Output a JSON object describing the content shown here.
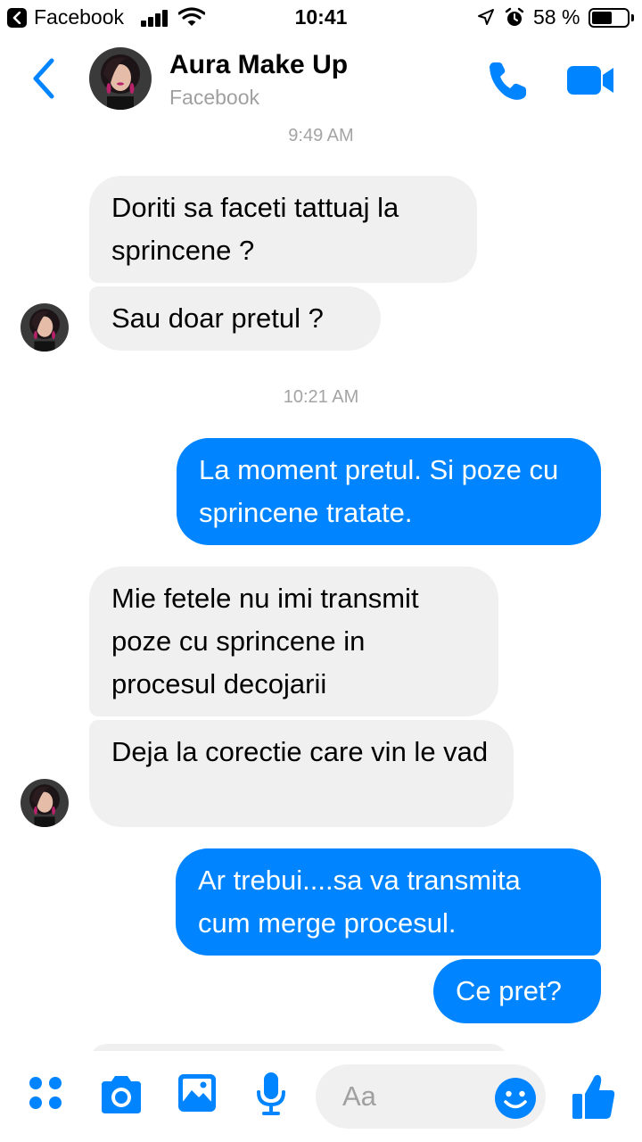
{
  "status_bar": {
    "back_app": "Facebook",
    "time": "10:41",
    "battery_pct": "58 %",
    "battery_level": 0.58
  },
  "header": {
    "contact_name": "Aura Make Up",
    "subtitle": "Facebook"
  },
  "messages": {
    "ts1": "9:49 AM",
    "m1": "Doriti sa faceti tattuaj la sprincene ?",
    "m2": "Sau doar pretul ?",
    "ts2": "10:21 AM",
    "m3": "La moment pretul. Si poze cu sprincene tratate.",
    "m4": "Mie fetele nu imi transmit poze cu sprincene in procesul decojarii",
    "m5": "Deja la corectie care vin le vad",
    "m6": "Ar trebui....sa va transmita cum merge procesul.",
    "m7": "Ce pret?"
  },
  "composer": {
    "placeholder": "Aa",
    "icons": [
      "apps-icon",
      "camera-icon",
      "gallery-icon",
      "microphone-icon",
      "emoji-icon",
      "like-icon"
    ]
  },
  "colors": {
    "accent": "#0084ff",
    "incoming_bubble": "#f0f0f0",
    "timestamp": "#a4a4a4"
  }
}
